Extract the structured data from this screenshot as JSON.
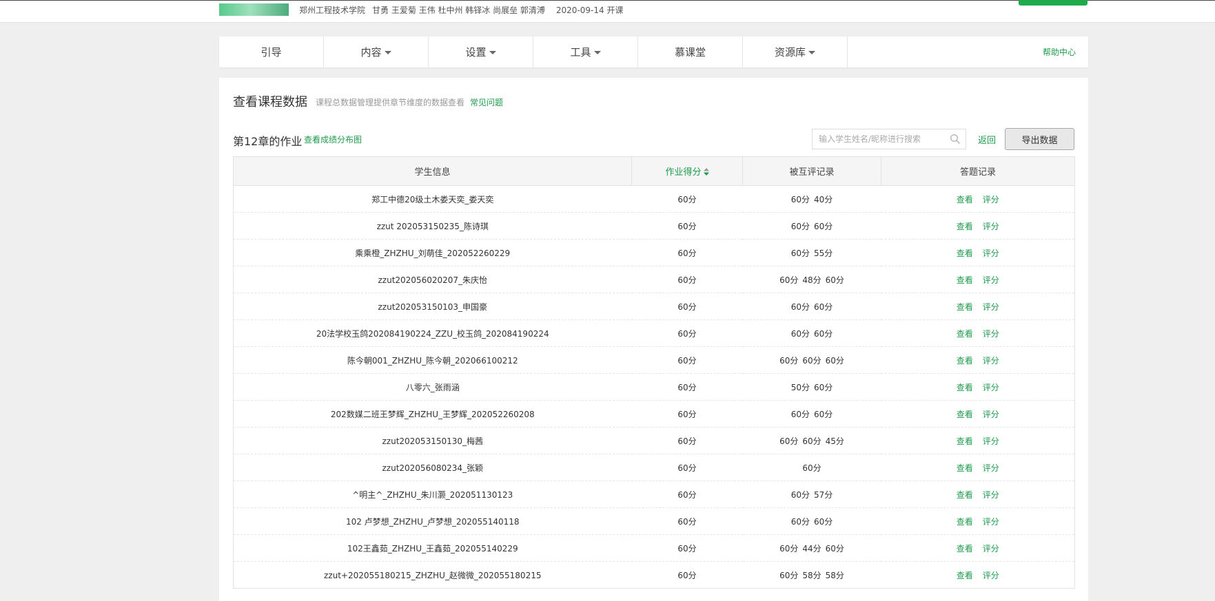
{
  "course": {
    "school": "郑州工程技术学院",
    "teachers": "甘勇 王爱菊 王伟 杜中州 韩铎冰 尚展垒 郭清溥",
    "start_date": "2020-09-14 开课"
  },
  "nav": {
    "items": [
      {
        "label": "引导",
        "dropdown": false
      },
      {
        "label": "内容",
        "dropdown": true
      },
      {
        "label": "设置",
        "dropdown": true
      },
      {
        "label": "工具",
        "dropdown": true
      },
      {
        "label": "慕课堂",
        "dropdown": false
      },
      {
        "label": "资源库",
        "dropdown": true
      }
    ],
    "help": "帮助中心"
  },
  "page": {
    "title": "查看课程数据",
    "description": "课程总数据管理提供章节维度的数据查看",
    "faq": "常见问题"
  },
  "section": {
    "title": "第12章的作业",
    "distribution_link": "查看成绩分布图"
  },
  "search": {
    "placeholder": "输入学生姓名/昵称进行搜索",
    "value": ""
  },
  "actions": {
    "back": "返回",
    "export": "导出数据"
  },
  "table": {
    "headers": [
      "学生信息",
      "作业得分",
      "被互评记录",
      "答题记录"
    ],
    "view_label": "查看",
    "grade_label": "评分",
    "rows": [
      {
        "student": "郑工中德20级土木娄天奕_娄天奕",
        "score": "60分",
        "peer": [
          "60分",
          "40分"
        ]
      },
      {
        "student": "zzut  202053150235_陈诗琪",
        "score": "60分",
        "peer": [
          "60分",
          "60分"
        ]
      },
      {
        "student": "乘乘橙_ZHZHU_刘萌佳_202052260229",
        "score": "60分",
        "peer": [
          "60分",
          "55分"
        ]
      },
      {
        "student": "zzut202056020207_朱庆怡",
        "score": "60分",
        "peer": [
          "60分",
          "48分",
          "60分"
        ]
      },
      {
        "student": "zzut202053150103_申国豪",
        "score": "60分",
        "peer": [
          "60分",
          "60分"
        ]
      },
      {
        "student": "20法学校玉鸽202084190224_ZZU_校玉鸽_202084190224",
        "score": "60分",
        "peer": [
          "60分",
          "60分"
        ]
      },
      {
        "student": "陈今朝001_ZHZHU_陈今朝_202066100212",
        "score": "60分",
        "peer": [
          "60分",
          "60分",
          "60分"
        ]
      },
      {
        "student": "八零六_张雨涵",
        "score": "60分",
        "peer": [
          "50分",
          "60分"
        ]
      },
      {
        "student": "202数媒二班王梦辉_ZHZHU_王梦辉_202052260208",
        "score": "60分",
        "peer": [
          "60分",
          "60分"
        ]
      },
      {
        "student": "zzut202053150130_梅茜",
        "score": "60分",
        "peer": [
          "60分",
          "60分",
          "45分"
        ]
      },
      {
        "student": "zzut202056080234_张颖",
        "score": "60分",
        "peer": [
          "60分"
        ]
      },
      {
        "student": "^明主^_ZHZHU_朱川灏_202051130123",
        "score": "60分",
        "peer": [
          "60分",
          "57分"
        ]
      },
      {
        "student": "102 卢梦想_ZHZHU_卢梦想_202055140118",
        "score": "60分",
        "peer": [
          "60分",
          "60分"
        ]
      },
      {
        "student": "102王鑫茹_ZHZHU_王鑫茹_202055140229",
        "score": "60分",
        "peer": [
          "60分",
          "44分",
          "60分"
        ]
      },
      {
        "student": "zzut+202055180215_ZHZHU_赵微微_202055180215",
        "score": "60分",
        "peer": [
          "60分",
          "58分",
          "58分"
        ]
      }
    ]
  },
  "colors": {
    "accent": "#1f9a4d",
    "background": "#efefef"
  }
}
